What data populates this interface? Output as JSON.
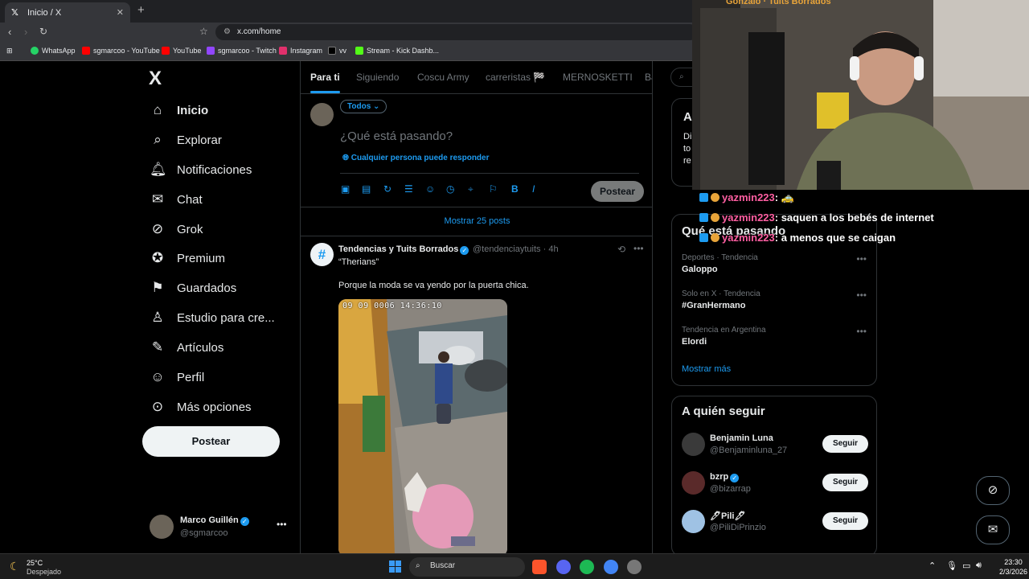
{
  "browser": {
    "tab_title": "Inicio / X",
    "tab_icon": "x-logo-icon",
    "url": "x.com/home",
    "new_tab": "+",
    "bookmarks": [
      {
        "label": "WhatsApp",
        "color": "#25d366"
      },
      {
        "label": "sgmarcoo - YouTube",
        "color": "#ff0000"
      },
      {
        "label": "YouTube",
        "color": "#ff0000"
      },
      {
        "label": "sgmarcoo - Twitch",
        "color": "#9146ff"
      },
      {
        "label": "Instagram",
        "color": "#e1306c"
      },
      {
        "label": "vv",
        "color": "#000000"
      },
      {
        "label": "Stream - Kick Dashb...",
        "color": "#53fc18"
      }
    ]
  },
  "sidebar": {
    "logo": "X",
    "items": [
      {
        "label": "Inicio",
        "icon": "home-icon"
      },
      {
        "label": "Explorar",
        "icon": "search-icon"
      },
      {
        "label": "Notificaciones",
        "icon": "bell-icon"
      },
      {
        "label": "Chat",
        "icon": "mail-icon"
      },
      {
        "label": "Grok",
        "icon": "grok-icon"
      },
      {
        "label": "Premium",
        "icon": "verified-icon"
      },
      {
        "label": "Guardados",
        "icon": "bookmark-icon"
      },
      {
        "label": "Estudio para cre...",
        "icon": "creator-studio-icon"
      },
      {
        "label": "Artículos",
        "icon": "articles-icon"
      },
      {
        "label": "Perfil",
        "icon": "user-icon"
      },
      {
        "label": "Más opciones",
        "icon": "more-circle-icon"
      }
    ],
    "post_button": "Postear",
    "profile": {
      "name": "Marco Guillén",
      "handle": "@sgmarcoo"
    }
  },
  "feed": {
    "tabs": [
      "Para ti",
      "Siguiendo",
      "Coscu Army",
      "carreristas 🏁",
      "MERNOSKETTI",
      "Ba"
    ],
    "composer": {
      "audience": "Todos",
      "placeholder": "¿Qué está pasando?",
      "reply_setting": "Cualquier persona puede responder",
      "post_button": "Postear"
    },
    "show_posts": "Mostrar 25 posts",
    "tweet": {
      "author": "Tendencias y Tuits Borrados",
      "handle": "@tendenciaytuits · 4h",
      "line1": "“Therians”",
      "line2": "Porque la moda se va yendo por la puerta chica.",
      "timestamp_overlay": "09 09 0006 14:36:10"
    }
  },
  "right": {
    "card1": {
      "heading": "A",
      "text": [
        "Di",
        "to",
        "re"
      ]
    },
    "trends": {
      "heading": "Qué está pasando",
      "items": [
        {
          "meta": "Deportes · Tendencia",
          "name": "Galoppo"
        },
        {
          "meta": "Solo en X · Tendencia",
          "name": "#GranHermano"
        },
        {
          "meta": "Tendencia en Argentina",
          "name": "Elordi"
        }
      ],
      "show_more": "Mostrar más"
    },
    "who_to_follow": {
      "heading": "A quién seguir",
      "items": [
        {
          "name": "Benjamin Luna",
          "handle": "@Benjaminluna_27",
          "button": "Seguir",
          "color": "#3a3a3a"
        },
        {
          "name": "bzrp",
          "handle": "@bizarrap",
          "button": "Seguir",
          "color": "#5a2a2a"
        },
        {
          "name": "🖊Pili🖊",
          "handle": "@PiliDiPrinzio",
          "button": "Seguir",
          "color": "#9fc2e4"
        }
      ],
      "more_cut": "Mostrar más"
    }
  },
  "overlay": {
    "top_text": "Gonzalo · Tuits Borrados",
    "chat": [
      {
        "user": "yazmin223",
        "msg": ": 🚕"
      },
      {
        "user": "yazmin223",
        "msg": ": saquen a los bebés de internet"
      },
      {
        "user": "yazmin223",
        "msg": ": a menos que se caigan"
      }
    ]
  },
  "taskbar": {
    "temp": "25°C",
    "weather": "Despejado",
    "search": "Buscar",
    "time": "23:30",
    "date": "2/3/2026"
  }
}
